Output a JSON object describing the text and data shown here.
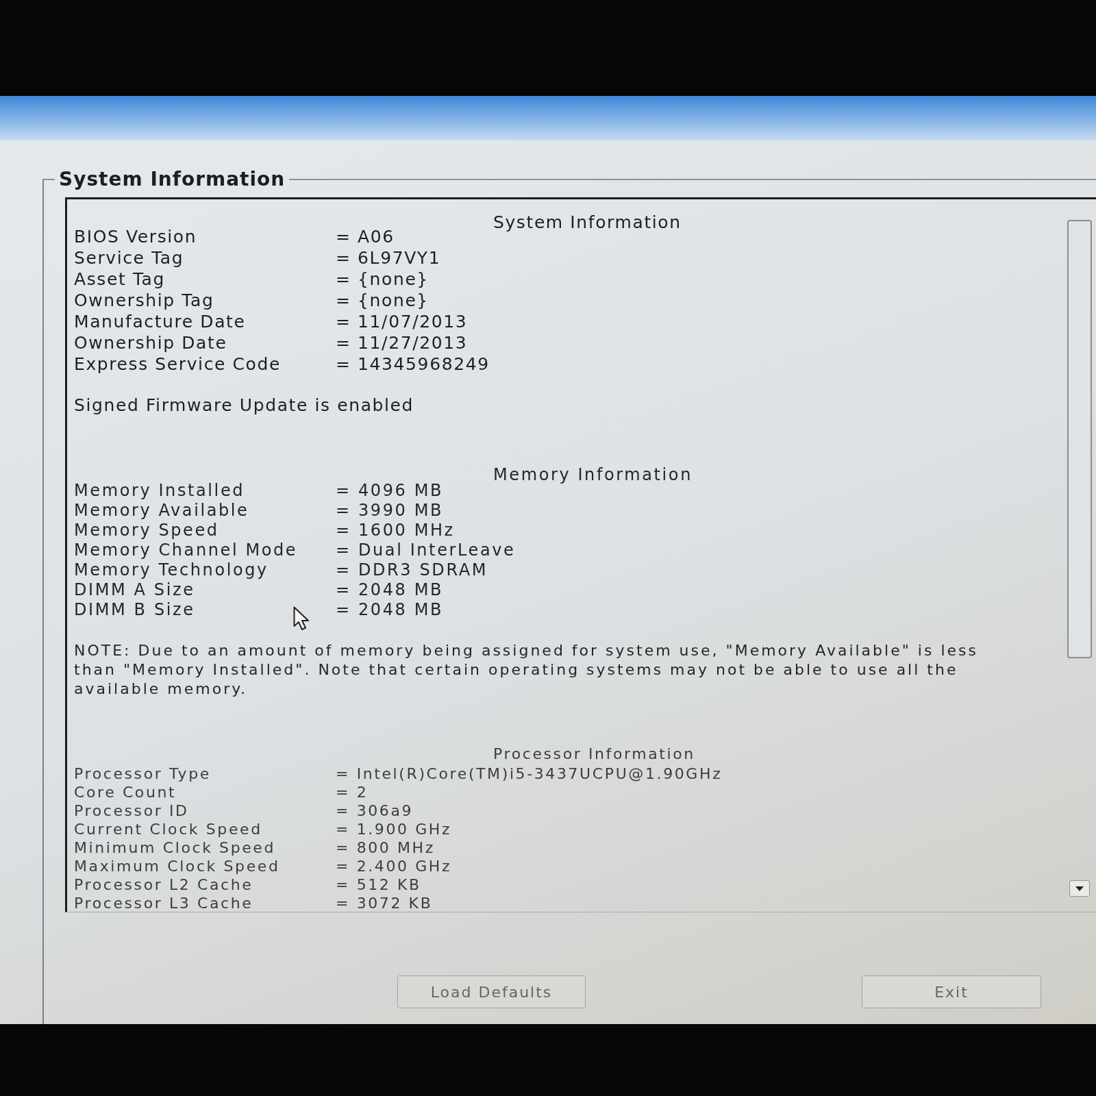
{
  "group_box": {
    "title": "System Information"
  },
  "sections": [
    {
      "heading": "System Information",
      "rows": [
        {
          "label": "BIOS Version",
          "value": "= A06"
        },
        {
          "label": "Service Tag",
          "value": "= 6L97VY1"
        },
        {
          "label": "Asset Tag",
          "value": "= {none}"
        },
        {
          "label": "Ownership Tag",
          "value": "= {none}"
        },
        {
          "label": "Manufacture Date",
          "value": "= 11/07/2013"
        },
        {
          "label": "Ownership Date",
          "value": "= 11/27/2013"
        },
        {
          "label": "Express Service Code",
          "value": "= 14345968249"
        }
      ],
      "note": "Signed Firmware Update is enabled"
    },
    {
      "heading": "Memory Information",
      "rows": [
        {
          "label": "Memory Installed",
          "value": "= 4096 MB"
        },
        {
          "label": "Memory Available",
          "value": "= 3990 MB"
        },
        {
          "label": "Memory Speed",
          "value": "= 1600 MHz"
        },
        {
          "label": "Memory Channel Mode",
          "value": "= Dual InterLeave"
        },
        {
          "label": "Memory Technology",
          "value": "= DDR3 SDRAM"
        },
        {
          "label": "DIMM A Size",
          "value": "= 2048 MB"
        },
        {
          "label": "DIMM B Size",
          "value": "= 2048 MB"
        }
      ],
      "note": "NOTE: Due to an amount of memory being assigned for system use, \"Memory Available\" is less than \"Memory Installed\". Note that certain operating systems may not be able to use all the available memory."
    },
    {
      "heading": "Processor Information",
      "rows": [
        {
          "label": "Processor Type",
          "value": "= Intel(R)Core(TM)i5-3437UCPU@1.90GHz"
        },
        {
          "label": "Core Count",
          "value": "= 2"
        },
        {
          "label": "Processor ID",
          "value": "= 306a9"
        },
        {
          "label": "Current Clock Speed",
          "value": "= 1.900 GHz"
        },
        {
          "label": "Minimum Clock Speed",
          "value": "= 800 MHz"
        },
        {
          "label": "Maximum Clock Speed",
          "value": "= 2.400 GHz"
        },
        {
          "label": "Processor L2 Cache",
          "value": "= 512 KB"
        },
        {
          "label": "Processor L3 Cache",
          "value": "= 3072 KB"
        }
      ]
    }
  ],
  "buttons": [
    {
      "label": "Load Defaults"
    },
    {
      "label": "Exit"
    }
  ]
}
